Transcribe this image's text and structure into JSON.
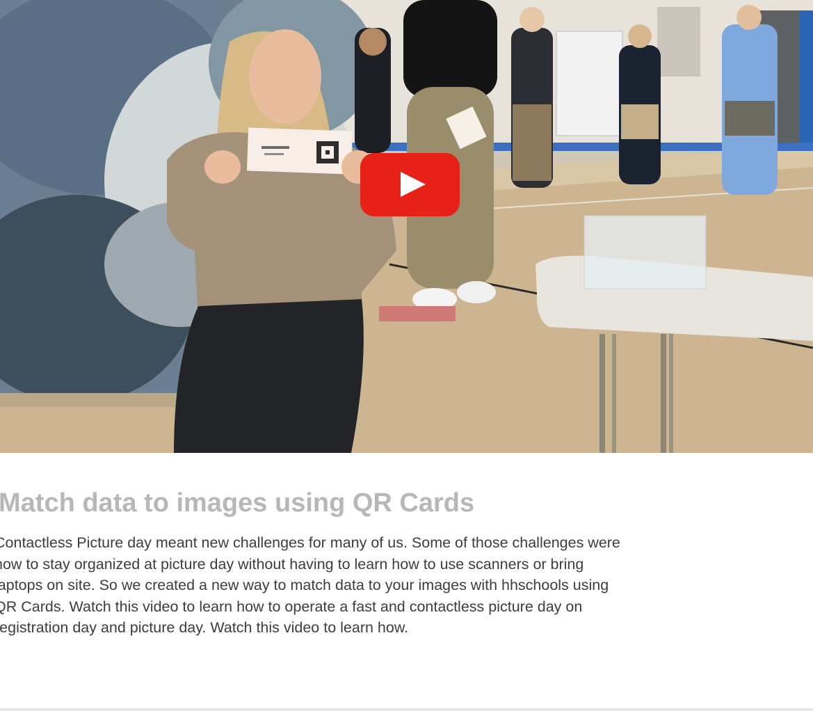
{
  "video": {
    "thumbnail": "Girl holding QR card at contactless picture day in school gym",
    "play_icon": "play-icon",
    "accent_color": "#e62117"
  },
  "post": {
    "title": "Match data to images using QR Cards",
    "body_lines": [
      "Contactless Picture day meant new challenges for many of us. Some of those challenges were",
      "how to stay organized at picture day without having to learn how to use scanners or bring",
      "laptops on site. So we created a new way to match data to your images with hhschools using",
      "QR Cards. Watch this video to learn how to operate a fast and contactless picture day on",
      "registration day and picture day. Watch this video to learn how."
    ]
  }
}
